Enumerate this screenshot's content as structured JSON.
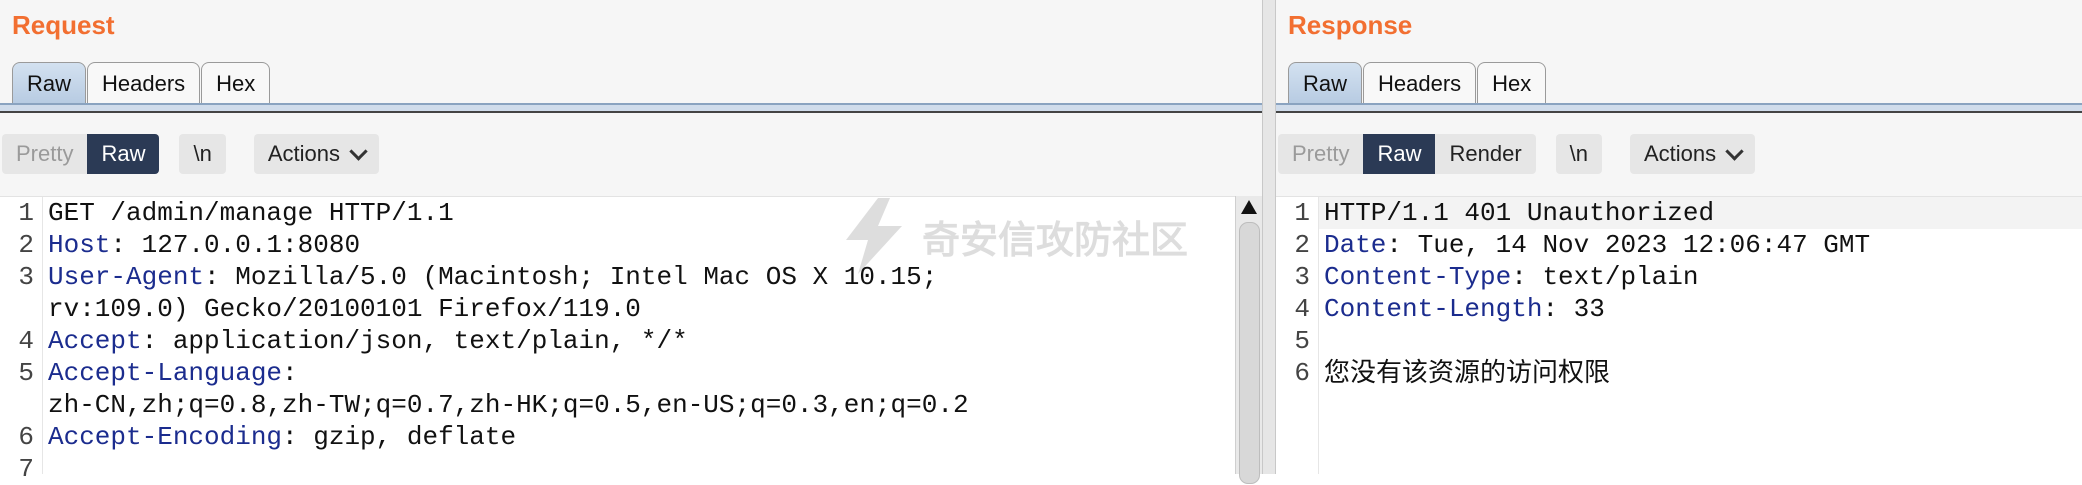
{
  "request": {
    "title": "Request",
    "tabs": [
      "Raw",
      "Headers",
      "Hex"
    ],
    "view_modes": [
      "Pretty",
      "Raw"
    ],
    "newline_label": "\\n",
    "actions_label": "Actions",
    "lines": [
      {
        "num": "1",
        "key": "",
        "rest": "GET /admin/manage HTTP/1.1"
      },
      {
        "num": "2",
        "key": "Host",
        "rest": ": 127.0.0.1:8080"
      },
      {
        "num": "3",
        "key": "User-Agent",
        "rest": ": Mozilla/5.0 (Macintosh; Intel Mac OS X 10.15;"
      },
      {
        "num": "",
        "key": "",
        "rest": "rv:109.0) Gecko/20100101 Firefox/119.0"
      },
      {
        "num": "4",
        "key": "Accept",
        "rest": ": application/json, text/plain, */*"
      },
      {
        "num": "5",
        "key": "Accept-Language",
        "rest": ":"
      },
      {
        "num": "",
        "key": "",
        "rest": "zh-CN,zh;q=0.8,zh-TW;q=0.7,zh-HK;q=0.5,en-US;q=0.3,en;q=0.2"
      },
      {
        "num": "6",
        "key": "Accept-Encoding",
        "rest": ": gzip, deflate"
      },
      {
        "num": "7",
        "key": "",
        "rest": ""
      }
    ],
    "watermark": "奇安信攻防社区"
  },
  "response": {
    "title": "Response",
    "tabs": [
      "Raw",
      "Headers",
      "Hex"
    ],
    "view_modes": [
      "Pretty",
      "Raw",
      "Render"
    ],
    "newline_label": "\\n",
    "actions_label": "Actions",
    "lines": [
      {
        "num": "1",
        "key": "",
        "rest": "HTTP/1.1 401 Unauthorized"
      },
      {
        "num": "2",
        "key": "Date",
        "rest": ": Tue, 14 Nov 2023 12:06:47 GMT"
      },
      {
        "num": "3",
        "key": "Content-Type",
        "rest": ": text/plain"
      },
      {
        "num": "4",
        "key": "Content-Length",
        "rest": ": 33"
      },
      {
        "num": "5",
        "key": "",
        "rest": ""
      },
      {
        "num": "6",
        "key": "",
        "rest": "您没有该资源的访问权限"
      }
    ]
  },
  "colors": {
    "title": "#f26f31",
    "header_key": "#1b2c8e",
    "active_mode": "#2b3a55"
  }
}
